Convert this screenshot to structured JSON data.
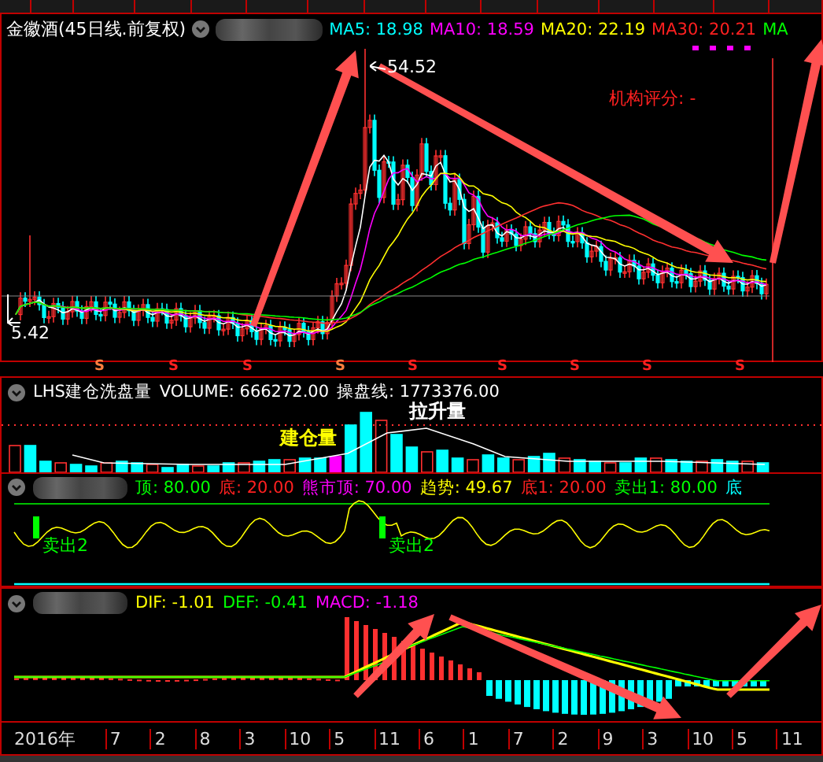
{
  "price_panel": {
    "title": "金徽酒(45日线.前复权)",
    "ma_values": [
      {
        "label": "MA5: 18.98",
        "color": "#00ffff"
      },
      {
        "label": "MA10: 18.59",
        "color": "#ff00ff"
      },
      {
        "label": "MA20: 22.19",
        "color": "#ffff00"
      },
      {
        "label": "MA30: 20.21",
        "color": "#ff2020"
      },
      {
        "label": "MA",
        "color": "#00ff00"
      }
    ],
    "high_label": "54.52",
    "low_label": "5.42",
    "rating": "机构评分: -"
  },
  "signal_marks": [
    {
      "text": "S",
      "color": "#ff8040"
    },
    {
      "text": "S",
      "color": "#ff2020"
    },
    {
      "text": "S",
      "color": "#ff2020"
    },
    {
      "text": "S",
      "color": "#ff8040"
    },
    {
      "text": "S",
      "color": "#ff2020"
    },
    {
      "text": "S",
      "color": "#ff2020"
    },
    {
      "text": "S",
      "color": "#ff2020"
    },
    {
      "text": "S",
      "color": "#ff2020"
    },
    {
      "text": "S",
      "color": "#ff2020"
    }
  ],
  "volume_panel": {
    "title": "LHS建仓洗盘量",
    "readings": [
      {
        "label": "VOLUME: 666272.00",
        "color": "#ffffff"
      },
      {
        "label": "操盘线: 1773376.00",
        "color": "#ffffff"
      }
    ],
    "labels": [
      {
        "text": "拉升量",
        "color": "#ffffff"
      },
      {
        "text": "建仓量",
        "color": "#ffff00"
      }
    ]
  },
  "indicator_panel": {
    "readings": [
      {
        "label": "顶: 80.00",
        "color": "#00ff00"
      },
      {
        "label": "底: 20.00",
        "color": "#ff2020"
      },
      {
        "label": "熊市顶: 70.00",
        "color": "#ff00ff"
      },
      {
        "label": "趋势: 49.67",
        "color": "#ffff00"
      },
      {
        "label": "底1: 20.00",
        "color": "#ff2020"
      },
      {
        "label": "卖出1: 80.00",
        "color": "#00ff00"
      },
      {
        "label": "底",
        "color": "#00ffff"
      }
    ],
    "signals": [
      "卖出2",
      "卖出2"
    ]
  },
  "macd_panel": {
    "readings": [
      {
        "label": "DIF: -1.01",
        "color": "#ffff00"
      },
      {
        "label": "DEF: -0.41",
        "color": "#00ff00"
      },
      {
        "label": "MACD: -1.18",
        "color": "#ff00ff"
      }
    ]
  },
  "time_axis": [
    "2016年",
    "7",
    "2",
    "8",
    "3",
    "10",
    "5",
    "11",
    "6",
    "1",
    "7",
    "2",
    "9",
    "3",
    "10",
    "5",
    "11"
  ]
}
